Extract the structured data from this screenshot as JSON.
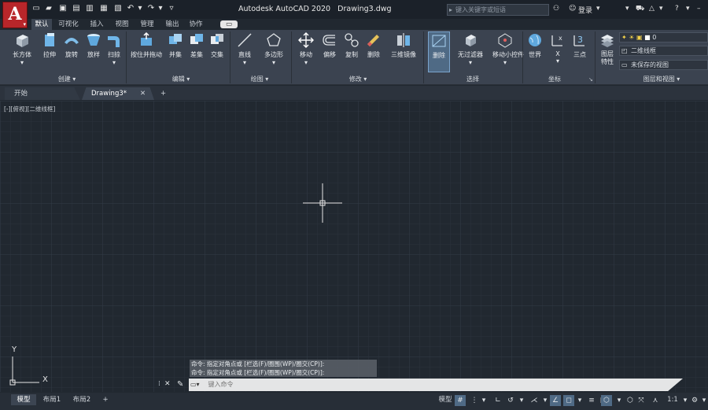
{
  "app": {
    "title": "Autodesk AutoCAD 2020",
    "doc_name": "Drawing3.dwg",
    "logo_letter": "A",
    "search_placeholder": "键入关键字或短语",
    "login": "登录"
  },
  "ribbon_tabs": [
    "默认",
    "可视化",
    "插入",
    "视图",
    "管理",
    "输出",
    "协作"
  ],
  "ribbon": {
    "create": {
      "title": "创建",
      "tools": [
        "长方体",
        "拉伸",
        "旋转",
        "放样",
        "扫掠"
      ]
    },
    "edit": {
      "title": "编辑",
      "tools": [
        "按住并拖动",
        "并集",
        "差集",
        "交集"
      ]
    },
    "draw": {
      "title": "绘图",
      "tools": [
        "直线",
        "多边形"
      ]
    },
    "modify": {
      "title": "修改",
      "tools": [
        "移动",
        "偏移",
        "复制",
        "删除",
        "三维镜像"
      ]
    },
    "select": {
      "title": "选择",
      "tools": [
        "删除",
        "无过滤器",
        "移动小控件"
      ]
    },
    "coords": {
      "title": "坐标",
      "tools": [
        "世界",
        "X",
        "三点"
      ]
    },
    "layers": {
      "title": "图层和视图",
      "tool": "图层特性",
      "layer_value": "0",
      "visual_style": "二维线框",
      "view": "未保存的视图"
    }
  },
  "doc_tabs": {
    "start": "开始",
    "drawing": "Drawing3*"
  },
  "viewport_caption": "[-][俯视][二维线框]",
  "ucs": {
    "x": "X",
    "y": "Y"
  },
  "command": {
    "history": [
      "命令: 指定对角点或 [栏选(F)/圈围(WP)/圈交(CP)]:",
      "命令: 指定对角点或 [栏选(F)/圈围(WP)/圈交(CP)]:"
    ],
    "placeholder": "键入命令"
  },
  "layout_tabs": [
    "模型",
    "布局1",
    "布局2"
  ],
  "status": {
    "model": "模型",
    "scale": "1:1"
  },
  "colors": {
    "canvas": "#212830",
    "ribbon": "#3b4350",
    "accent": "#b8262a"
  }
}
